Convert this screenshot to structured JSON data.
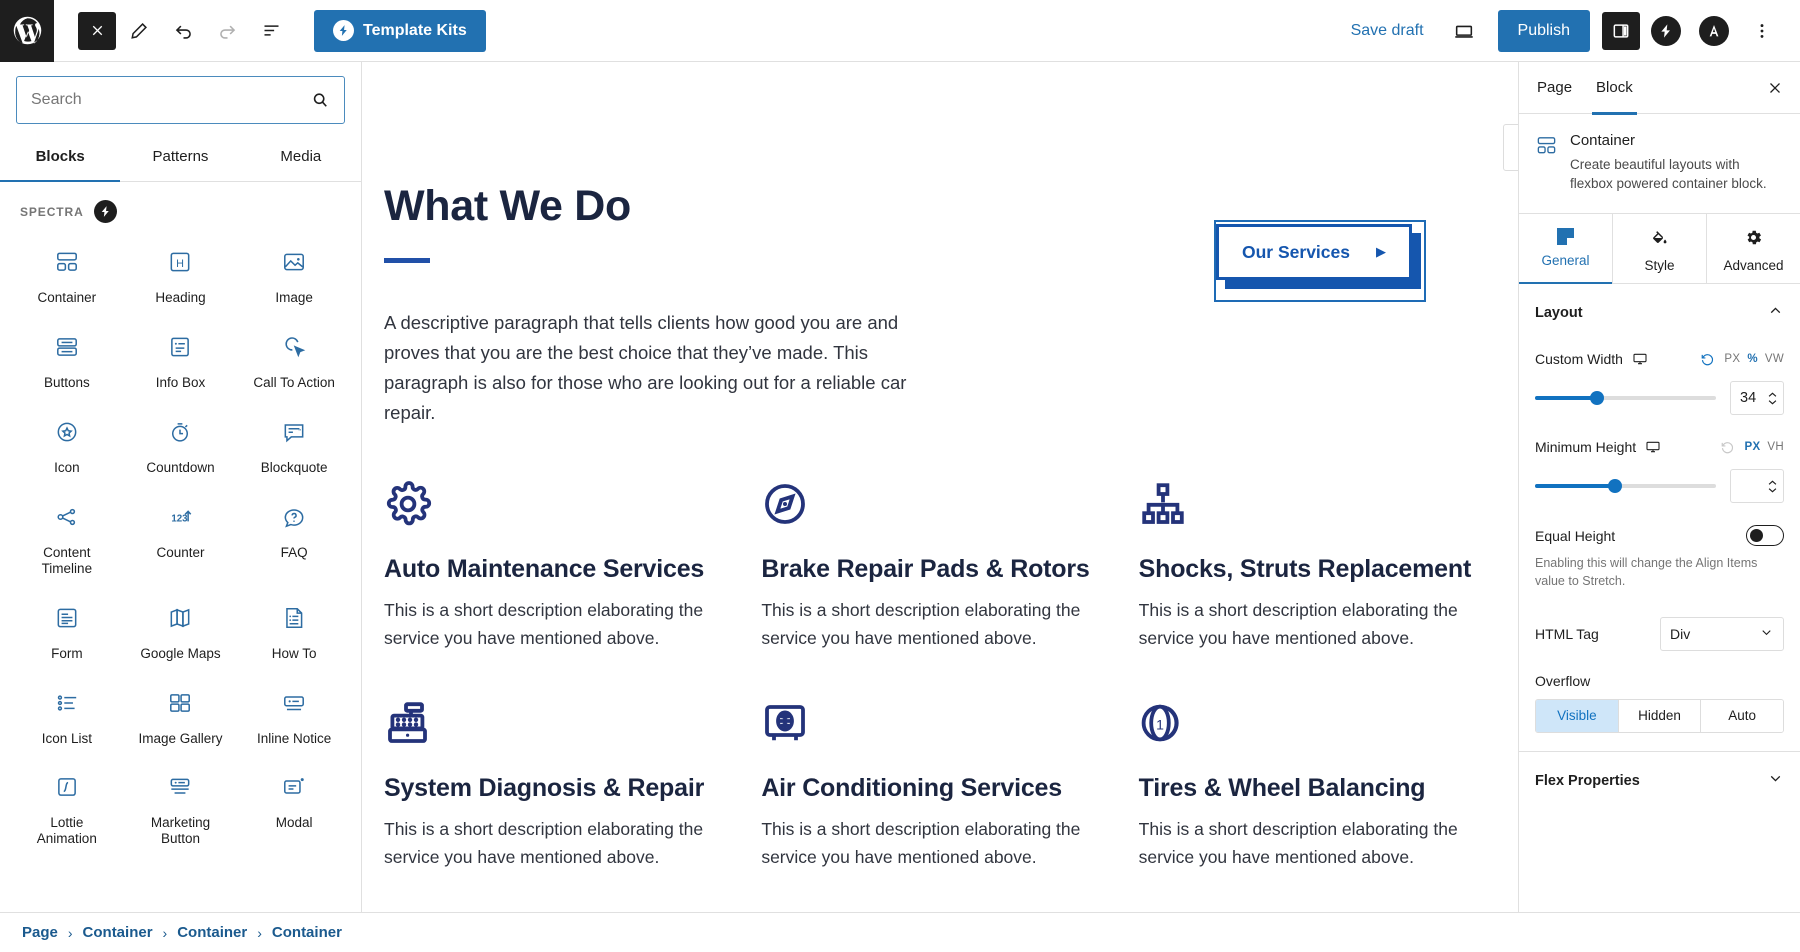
{
  "topbar": {
    "logo_icon": "wordpress-logo-icon",
    "close_icon": "close-icon",
    "edit_icon": "pencil-icon",
    "undo_icon": "undo-icon",
    "redo_icon": "redo-icon",
    "list_view_icon": "document-overview-icon",
    "template_kits_label": "Template Kits",
    "save_draft_label": "Save draft",
    "preview_icon": "desktop-preview-icon",
    "publish_label": "Publish",
    "sidebar_toggle_icon": "settings-sidebar-icon",
    "spectra_icon": "spectra-icon",
    "astra_icon": "astra-icon",
    "more_icon": "more-options-icon"
  },
  "inserter": {
    "search": {
      "value": "",
      "placeholder": "Search",
      "icon": "search-icon"
    },
    "tabs": [
      {
        "label": "Blocks",
        "active": true
      },
      {
        "label": "Patterns",
        "active": false
      },
      {
        "label": "Media",
        "active": false
      }
    ],
    "category": {
      "label": "SPECTRA",
      "icon": "spectra-icon"
    },
    "blocks": [
      {
        "label": "Container",
        "icon": "container-icon"
      },
      {
        "label": "Heading",
        "icon": "heading-icon"
      },
      {
        "label": "Image",
        "icon": "image-icon"
      },
      {
        "label": "Buttons",
        "icon": "buttons-icon"
      },
      {
        "label": "Info Box",
        "icon": "info-box-icon"
      },
      {
        "label": "Call To Action",
        "icon": "call-to-action-icon"
      },
      {
        "label": "Icon",
        "icon": "icon-star-icon"
      },
      {
        "label": "Countdown",
        "icon": "countdown-icon"
      },
      {
        "label": "Blockquote",
        "icon": "blockquote-icon"
      },
      {
        "label": "Content Timeline",
        "icon": "content-timeline-icon"
      },
      {
        "label": "Counter",
        "icon": "counter-icon"
      },
      {
        "label": "FAQ",
        "icon": "faq-icon"
      },
      {
        "label": "Form",
        "icon": "form-icon"
      },
      {
        "label": "Google Maps",
        "icon": "google-maps-icon"
      },
      {
        "label": "How To",
        "icon": "how-to-icon"
      },
      {
        "label": "Icon List",
        "icon": "icon-list-icon"
      },
      {
        "label": "Image Gallery",
        "icon": "image-gallery-icon"
      },
      {
        "label": "Inline Notice",
        "icon": "inline-notice-icon"
      },
      {
        "label": "Lottie Animation",
        "icon": "lottie-animation-icon"
      },
      {
        "label": "Marketing Button",
        "icon": "marketing-button-icon"
      },
      {
        "label": "Modal",
        "icon": "modal-icon"
      }
    ]
  },
  "block_toolbar": {
    "parent_icon": "select-parent-container-icon",
    "block_type_icon": "container-icon",
    "drag_icon": "drag-handle-icon",
    "move_up_icon": "chevron-up-icon",
    "move_down_icon": "chevron-down-icon",
    "brush_icon": "spectra-copy-paste-icon",
    "options_icon": "more-options-icon"
  },
  "canvas": {
    "title": "What We Do",
    "paragraph": "A descriptive paragraph that tells clients how good you are and proves that you are the best choice that they’ve made. This paragraph is also for those who are looking out for a reliable car repair.",
    "cta": {
      "label": "Our Services",
      "arrow_icon": "arrow-right-icon"
    },
    "cards": [
      {
        "icon": "gear-icon",
        "title": "Auto Maintenance Services",
        "desc": "This is a short description elaborating the service you have mentioned above."
      },
      {
        "icon": "compass-icon",
        "title": "Brake Repair Pads & Rotors",
        "desc": "This is a short description elaborating the service you have mentioned above."
      },
      {
        "icon": "sitemap-icon",
        "title": "Shocks, Struts Replacement",
        "desc": "This is a short description elaborating the service you have mentioned above."
      },
      {
        "icon": "cash-register-icon",
        "title": "System Diagnosis & Repair",
        "desc": "This is a short description elaborating the service you have mentioned above."
      },
      {
        "icon": "safe-box-icon",
        "title": "Air Conditioning Services",
        "desc": "This is a short description elaborating the service you have mentioned above."
      },
      {
        "icon": "coin-icon",
        "title": "Tires & Wheel Balancing",
        "desc": "This is a short description elaborating the service you have mentioned above."
      }
    ]
  },
  "settings": {
    "tabs": [
      {
        "label": "Page",
        "active": false
      },
      {
        "label": "Block",
        "active": true
      }
    ],
    "close_icon": "close-icon",
    "block": {
      "icon": "container-icon",
      "name": "Container",
      "description": "Create beautiful layouts with flexbox powered container block."
    },
    "seg_tabs": [
      {
        "label": "General",
        "icon": "general-icon",
        "active": true
      },
      {
        "label": "Style",
        "icon": "paint-bucket-icon",
        "active": false
      },
      {
        "label": "Advanced",
        "icon": "gear-icon",
        "active": false
      }
    ],
    "layout": {
      "title": "Layout",
      "chevron_icon": "chevron-up-icon",
      "custom_width": {
        "label": "Custom Width",
        "device_icon": "desktop-icon",
        "reset_icon": "reset-icon",
        "units": [
          {
            "label": "PX",
            "active": false
          },
          {
            "label": "%",
            "active": true
          },
          {
            "label": "VW",
            "active": false
          }
        ],
        "value": "34",
        "slider_percent": 34
      },
      "minimum_height": {
        "label": "Minimum Height",
        "device_icon": "desktop-icon",
        "reset_icon": "reset-icon",
        "units": [
          {
            "label": "PX",
            "active": true
          },
          {
            "label": "VH",
            "active": false
          }
        ],
        "value": "",
        "slider_percent": 44
      },
      "equal_height": {
        "label": "Equal Height",
        "enabled": false,
        "help": "Enabling this will change the Align Items value to Stretch."
      },
      "html_tag": {
        "label": "HTML Tag",
        "value": "Div",
        "chevron_icon": "chevron-down-icon"
      },
      "overflow": {
        "label": "Overflow",
        "options": [
          {
            "label": "Visible",
            "active": true
          },
          {
            "label": "Hidden",
            "active": false
          },
          {
            "label": "Auto",
            "active": false
          }
        ]
      }
    },
    "flex_properties": {
      "title": "Flex Properties",
      "chevron_icon": "chevron-down-icon"
    }
  },
  "breadcrumb": [
    {
      "label": "Page"
    },
    {
      "label": "Container"
    },
    {
      "label": "Container"
    },
    {
      "label": "Container"
    }
  ],
  "colors": {
    "accent": "#2271b1",
    "brand_navy": "#24337a",
    "canvas_heading": "#1b2540",
    "cta_blue": "#1556ae"
  }
}
